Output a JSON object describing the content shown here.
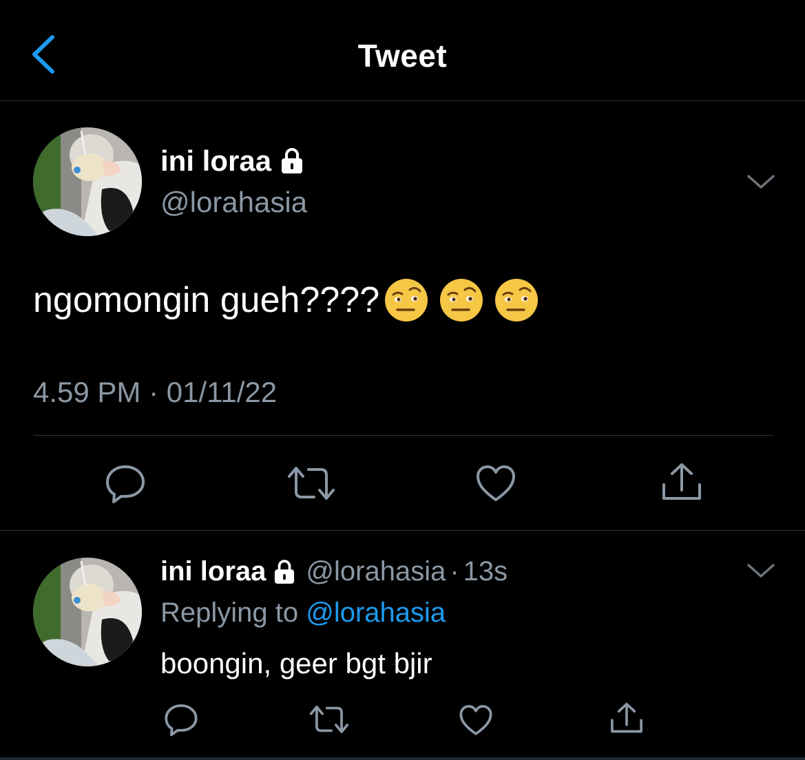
{
  "header": {
    "title": "Tweet"
  },
  "tweet": {
    "name": "ini loraa",
    "handle": "@lorahasia",
    "text": "ngomongin gueh????",
    "emojis": [
      "raised-eyebrow-emoji",
      "raised-eyebrow-emoji",
      "raised-eyebrow-emoji"
    ],
    "timestamp": "4.59 PM · 01/11/22"
  },
  "reply": {
    "name": "ini loraa",
    "handle": "@lorahasia",
    "separator": "·",
    "time": "13s",
    "replying_prefix": "Replying to",
    "replying_to": "@lorahasia",
    "text": "boongin, geer bgt bjir"
  },
  "colors": {
    "background": "#000000",
    "muted": "#8b98a5",
    "accent": "#1d9bf0",
    "divider": "#2f3336"
  },
  "icons": [
    "back-chevron-icon",
    "lock-icon",
    "chevron-down-icon",
    "reply-icon",
    "retweet-icon",
    "like-icon",
    "share-icon"
  ]
}
